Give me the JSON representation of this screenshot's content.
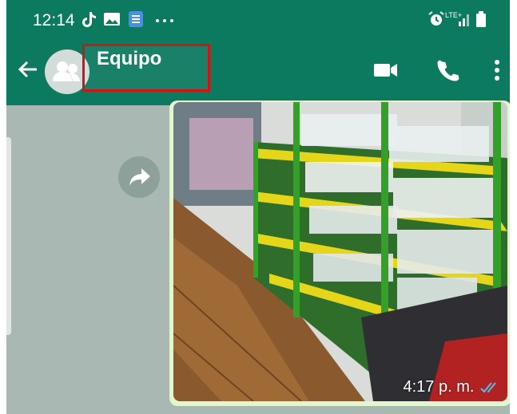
{
  "status_bar": {
    "time": "12:14",
    "network_label": "LTE+",
    "icons": [
      "tiktok-icon",
      "gallery-icon",
      "sim-app-icon",
      "more-dots-icon",
      "alarm-icon",
      "signal-icon",
      "battery-icon"
    ]
  },
  "header": {
    "title": "Equipo",
    "icons": [
      "back-arrow-icon",
      "group-avatar-icon",
      "video-call-icon",
      "voice-call-icon",
      "overflow-menu-icon"
    ]
  },
  "message": {
    "time": "4:17 p. m.",
    "status": "read",
    "status_icon": "double-check-icon"
  },
  "colors": {
    "primary": "#0b7a5e",
    "chat_background": "#a9b8b3",
    "outgoing_bubble": "#e2f6d0",
    "highlight_box": "#d41414",
    "read_ticks": "#53bdeb"
  }
}
